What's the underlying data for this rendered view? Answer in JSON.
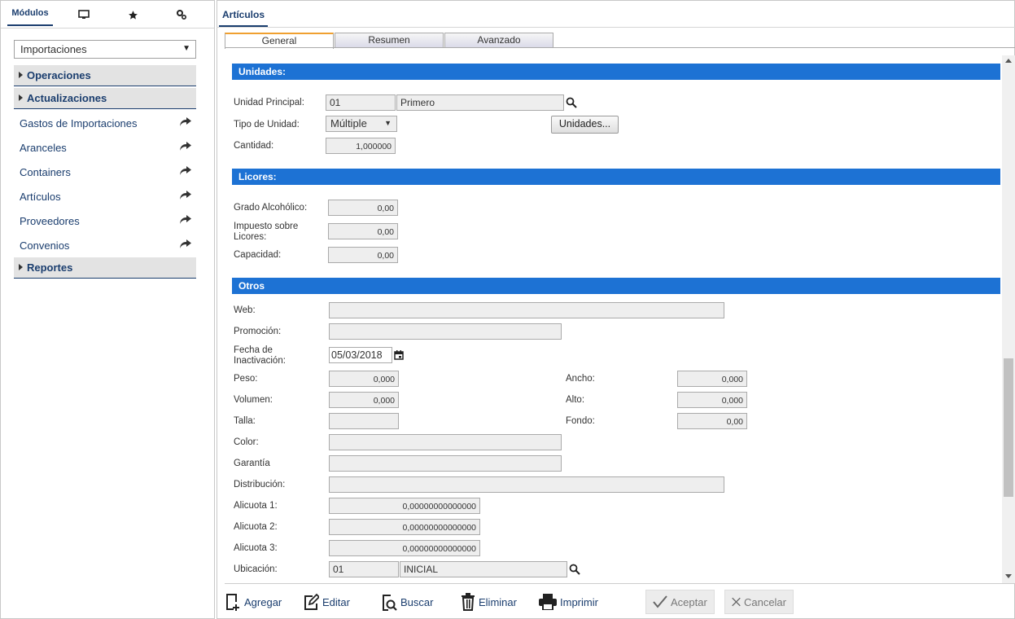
{
  "left_tabs": {
    "modulos": "Módulos",
    "icons": [
      "monitor-icon",
      "star-icon",
      "settings-icon"
    ]
  },
  "modules_select": {
    "value": "Importaciones"
  },
  "menu": {
    "operaciones": "Operaciones",
    "actualizaciones": "Actualizaciones",
    "items": [
      "Gastos de Importaciones",
      "Aranceles",
      "Containers",
      "Artículos",
      "Proveedores",
      "Convenios"
    ],
    "reportes": "Reportes"
  },
  "right_tab": "Artículos",
  "subtabs": [
    "General",
    "Resumen",
    "Avanzado"
  ],
  "sections": {
    "unidades": "Unidades:",
    "licores": "Licores:",
    "otros": "Otros"
  },
  "unidades": {
    "unidad_principal_label": "Unidad Principal:",
    "unidad_code": "01",
    "unidad_name": "Primero",
    "tipo_label": "Tipo de Unidad:",
    "tipo_value": "Múltiple",
    "unidades_button": "Unidades...",
    "cantidad_label": "Cantidad:",
    "cantidad_value": "1,000000"
  },
  "licores": {
    "grado_label": "Grado Alcohólico:",
    "grado_value": "0,00",
    "impuesto_label_1": "Impuesto sobre",
    "impuesto_label_2": "Licores:",
    "impuesto_value": "0,00",
    "capacidad_label": "Capacidad:",
    "capacidad_value": "0,00"
  },
  "otros": {
    "web_label": "Web:",
    "web_value": "",
    "promocion_label": "Promoción:",
    "promocion_value": "",
    "fecha_label_1": "Fecha de",
    "fecha_label_2": "Inactivación:",
    "fecha_value": "05/03/2018",
    "peso_label": "Peso:",
    "peso_value": "0,000",
    "volumen_label": "Volumen:",
    "volumen_value": "0,000",
    "talla_label": "Talla:",
    "talla_value": "",
    "ancho_label": "Ancho:",
    "ancho_value": "0,000",
    "alto_label": "Alto:",
    "alto_value": "0,000",
    "fondo_label": "Fondo:",
    "fondo_value": "0,00",
    "color_label": "Color:",
    "color_value": "",
    "garantia_label": "Garantía",
    "garantia_value": "",
    "distribucion_label": "Distribución:",
    "distribucion_value": "",
    "alicuota1_label": "Alicuota 1:",
    "alicuota1_value": "0,00000000000000",
    "alicuota2_label": "Alicuota 2:",
    "alicuota2_value": "0,00000000000000",
    "alicuota3_label": "Alicuota 3:",
    "alicuota3_value": "0,00000000000000",
    "ubicacion_label": "Ubicación:",
    "ubicacion_code": "01",
    "ubicacion_name": "INICIAL"
  },
  "toolbar": {
    "agregar": "Agregar",
    "editar": "Editar",
    "buscar": "Buscar",
    "eliminar": "Eliminar",
    "imprimir": "Imprimir",
    "aceptar": "Aceptar",
    "cancelar": "Cancelar"
  },
  "colors": {
    "section_blue": "#1d72d4",
    "nav_text": "#1a3d6e",
    "active_tab_accent": "#f0a030"
  }
}
